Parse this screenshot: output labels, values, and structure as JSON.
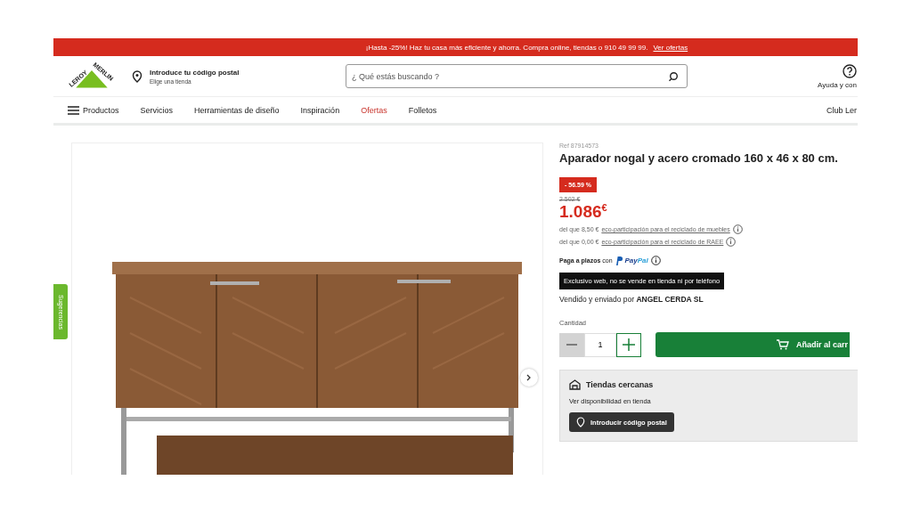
{
  "promo_bar": {
    "text": "¡Hasta -25%! Haz tu casa más eficiente y ahorra. Compra online, tiendas o 910 49 99 99.",
    "link": "Ver ofertas"
  },
  "header": {
    "logo": {
      "line_1": "LEROY",
      "line_2": "MERLIN"
    },
    "location": {
      "title": "Introduce tu código postal",
      "subtitle": "Elige una tienda"
    },
    "search": {
      "placeholder": "¿ Qué estás buscando ?"
    },
    "help": "Ayuda y con"
  },
  "nav": {
    "items": [
      {
        "label": "Productos",
        "kind": "menu",
        "highlighted": false
      },
      {
        "label": "Servicios",
        "kind": "link",
        "highlighted": false
      },
      {
        "label": "Herramientas de diseño",
        "kind": "link",
        "highlighted": false
      },
      {
        "label": "Inspiración",
        "kind": "link",
        "highlighted": false
      },
      {
        "label": "Ofertas",
        "kind": "link",
        "highlighted": true
      },
      {
        "label": "Folletos",
        "kind": "link",
        "highlighted": false
      }
    ],
    "right": "Club Ler"
  },
  "side_tab": "Sugerencias",
  "product": {
    "ref": "Ref 87914573",
    "title": "Aparador nogal y acero cromado 160 x 46 x 80 cm.",
    "discount": "- 56.59 %",
    "old_price": "2.502 €",
    "price": "1.086",
    "currency": "€",
    "eco_fees": [
      {
        "prefix": "del que 8,50 €",
        "link": "eco-participación para el reciclado de muebles"
      },
      {
        "prefix": "del que 0,00 €",
        "link": "eco-participación para el reciclado de RAEE"
      }
    ],
    "installments": {
      "text": "Paga a plazos",
      "connector": "con",
      "brand_1": "Pay",
      "brand_2": "Pal"
    },
    "exclusive_notice": "Exclusivo web, no se vende en tienda ni por teléfono",
    "seller": "Vendido y enviado por **ANGEL CERDA SL**",
    "quantity": {
      "label": "Cantidad",
      "value": "1"
    },
    "add_to_cart": "Añadir al carr",
    "stores": {
      "title": "Tiendas cercanas",
      "subtitle": "Ver disponibilidad en tienda",
      "button": "Introducir código postal"
    }
  }
}
